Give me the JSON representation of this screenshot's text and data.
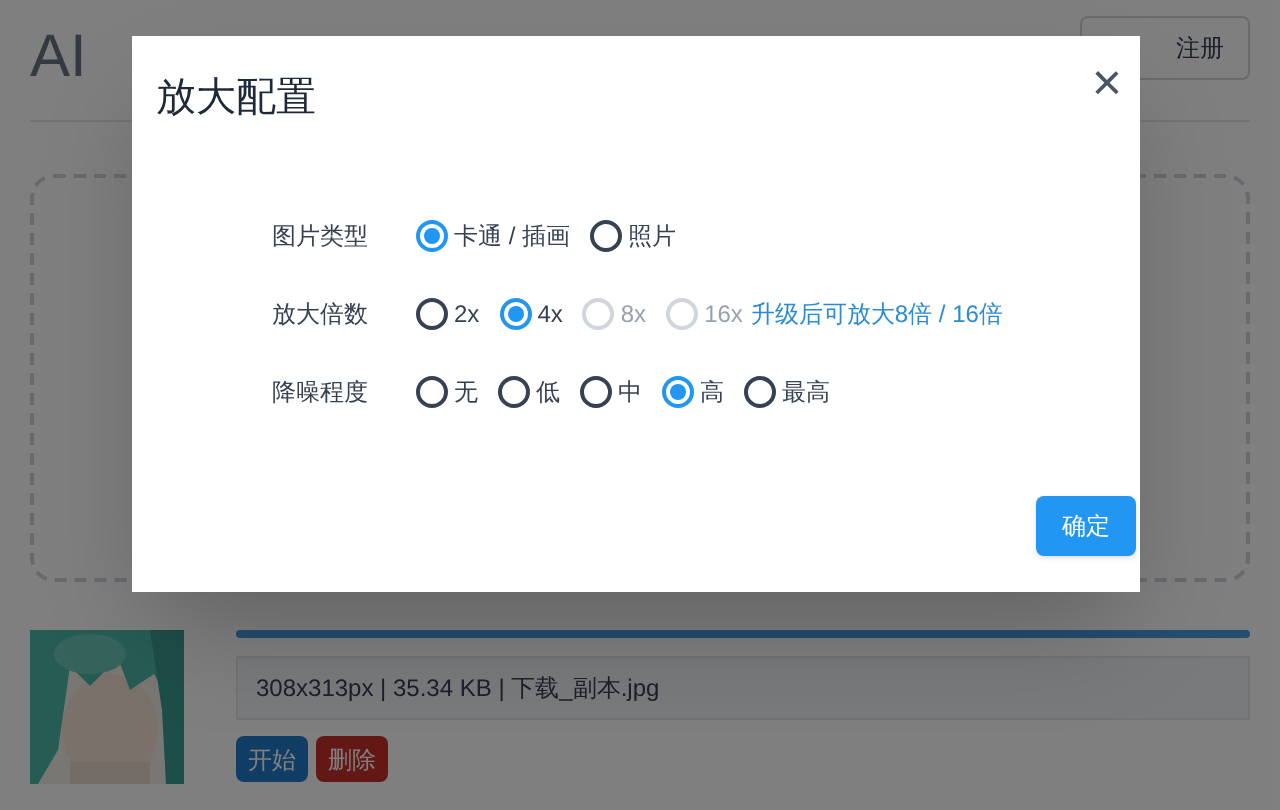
{
  "page": {
    "title": "AI",
    "account_button": "注册",
    "file": {
      "progress": {
        "level": 1
      },
      "info": "308x313px | 35.34 KB | 下载_副本.jpg",
      "buttons": [
        {
          "label": "开始",
          "kind": "primary"
        },
        {
          "label": "删除",
          "kind": "danger"
        }
      ]
    }
  },
  "dialog": {
    "title": "放大配置",
    "close": "×",
    "rows": [
      {
        "label": "图片类型",
        "options": [
          {
            "label": "卡通 / 插画",
            "selected": true,
            "disabled": false
          },
          {
            "label": "照片",
            "selected": false,
            "disabled": false
          }
        ]
      },
      {
        "label": "放大倍数",
        "options": [
          {
            "label": "2x",
            "selected": false,
            "disabled": false
          },
          {
            "label": "4x",
            "selected": true,
            "disabled": false
          },
          {
            "label": "8x",
            "selected": false,
            "disabled": true
          },
          {
            "label": "16x",
            "selected": false,
            "disabled": true
          }
        ],
        "note": "升级后可放大8倍 / 16倍"
      },
      {
        "label": "降噪程度",
        "options": [
          {
            "label": "无",
            "selected": false,
            "disabled": false
          },
          {
            "label": "低",
            "selected": false,
            "disabled": false
          },
          {
            "label": "中",
            "selected": false,
            "disabled": false
          },
          {
            "label": "高",
            "selected": true,
            "disabled": false
          },
          {
            "label": "最高",
            "selected": false,
            "disabled": false
          }
        ]
      }
    ],
    "confirm": "确定"
  }
}
